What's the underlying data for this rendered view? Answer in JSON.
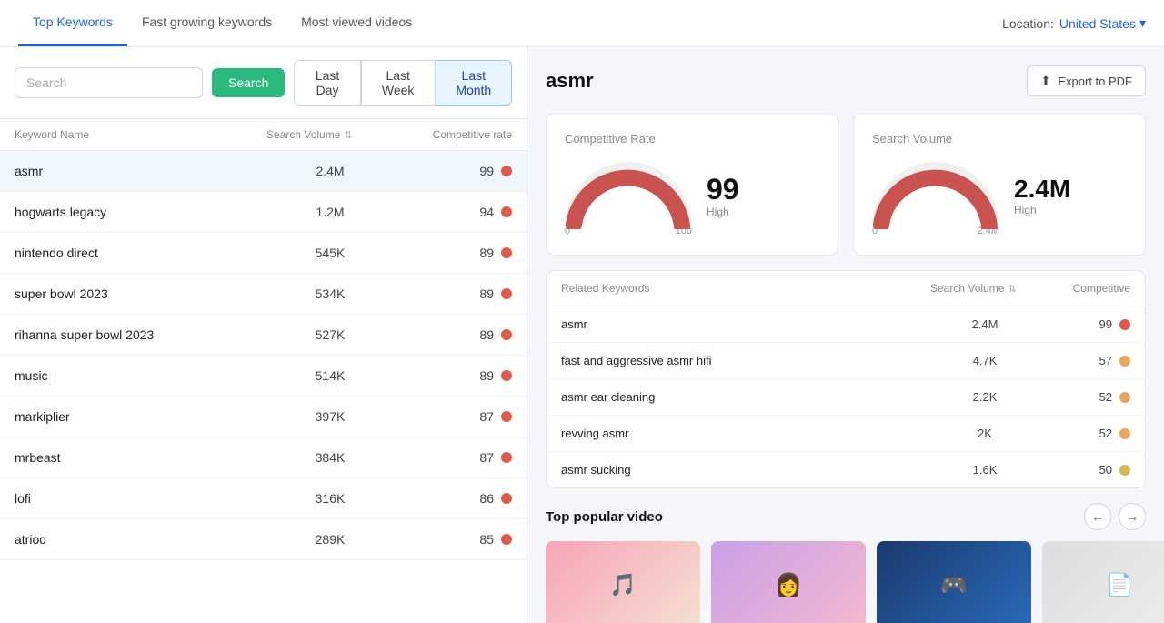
{
  "nav": {
    "tabs": [
      {
        "label": "Top Keywords",
        "active": true
      },
      {
        "label": "Fast growing keywords",
        "active": false
      },
      {
        "label": "Most viewed videos",
        "active": false
      }
    ],
    "location_label": "Location:",
    "location_value": "United States"
  },
  "toolbar": {
    "search_placeholder": "Search",
    "search_button": "Search",
    "time_filters": [
      {
        "label": "Last Day",
        "active": false
      },
      {
        "label": "Last Week",
        "active": false
      },
      {
        "label": "Last Month",
        "active": true
      }
    ]
  },
  "table": {
    "col_keyword": "Keyword Name",
    "col_search_volume": "Search Volume",
    "col_competitive": "Competitive rate",
    "rows": [
      {
        "keyword": "asmr",
        "volume": "2.4M",
        "rate": 99,
        "color": "red",
        "selected": true
      },
      {
        "keyword": "hogwarts legacy",
        "volume": "1.2M",
        "rate": 94,
        "color": "red",
        "selected": false
      },
      {
        "keyword": "nintendo direct",
        "volume": "545K",
        "rate": 89,
        "color": "red",
        "selected": false
      },
      {
        "keyword": "super bowl 2023",
        "volume": "534K",
        "rate": 89,
        "color": "red",
        "selected": false
      },
      {
        "keyword": "rihanna super bowl 2023",
        "volume": "527K",
        "rate": 89,
        "color": "red",
        "selected": false
      },
      {
        "keyword": "music",
        "volume": "514K",
        "rate": 89,
        "color": "red",
        "selected": false
      },
      {
        "keyword": "markiplier",
        "volume": "397K",
        "rate": 87,
        "color": "red",
        "selected": false
      },
      {
        "keyword": "mrbeast",
        "volume": "384K",
        "rate": 87,
        "color": "red",
        "selected": false
      },
      {
        "keyword": "lofi",
        "volume": "316K",
        "rate": 86,
        "color": "red",
        "selected": false
      },
      {
        "keyword": "atrioc",
        "volume": "289K",
        "rate": 85,
        "color": "red",
        "selected": false
      }
    ]
  },
  "detail": {
    "title": "asmr",
    "export_button": "Export to PDF",
    "competitive_rate": {
      "card_title": "Competitive Rate",
      "value": "99",
      "label": "High",
      "gauge_min": "0",
      "gauge_max": "100"
    },
    "search_volume": {
      "card_title": "Search Volume",
      "value": "2.4M",
      "label": "High",
      "gauge_min": "0",
      "gauge_max": "2.4M"
    },
    "related_keywords": {
      "title": "Related Keywords",
      "col_volume": "Search Volume",
      "col_competitive": "Competitive",
      "rows": [
        {
          "keyword": "asmr",
          "volume": "2.4M",
          "rate": 99,
          "color": "red"
        },
        {
          "keyword": "fast and aggressive asmr hifi",
          "volume": "4.7K",
          "rate": 57,
          "color": "orange"
        },
        {
          "keyword": "asmr ear cleaning",
          "volume": "2.2K",
          "rate": 52,
          "color": "orange"
        },
        {
          "keyword": "revving asmr",
          "volume": "2K",
          "rate": 52,
          "color": "orange"
        },
        {
          "keyword": "asmr sucking",
          "volume": "1.6K",
          "rate": 50,
          "color": "yellow"
        }
      ]
    },
    "popular_video": {
      "title": "Top popular video",
      "videos": [
        {
          "thumb_class": "thumb-1",
          "icon": "🎵"
        },
        {
          "thumb_class": "thumb-2",
          "icon": "👩"
        },
        {
          "thumb_class": "thumb-3",
          "icon": "🎮"
        },
        {
          "thumb_class": "thumb-4",
          "icon": "📄"
        }
      ]
    }
  }
}
